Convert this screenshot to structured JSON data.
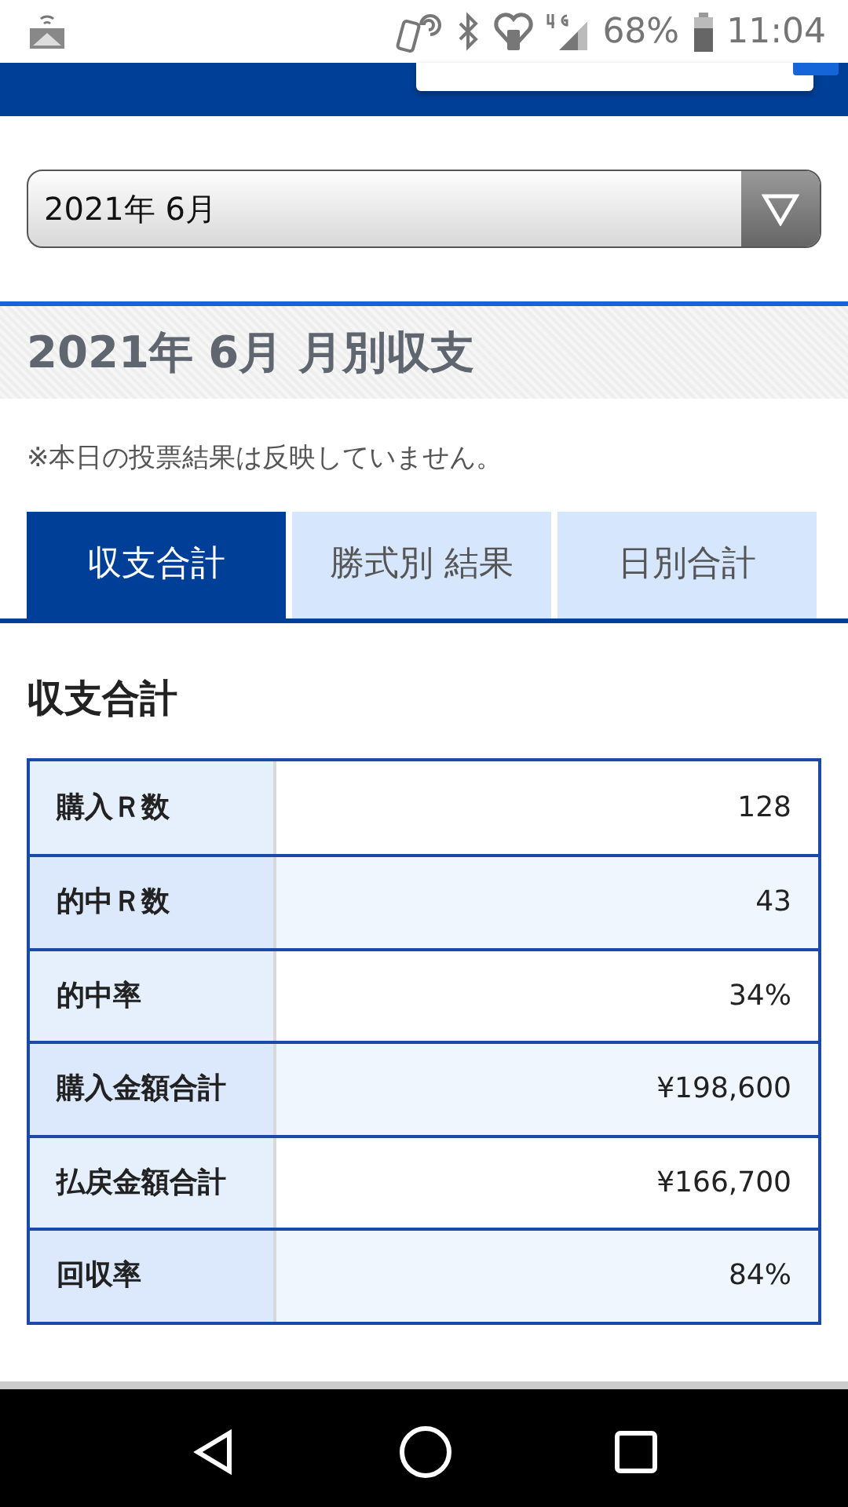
{
  "status_bar": {
    "battery": "68%",
    "time": "11:04"
  },
  "month_select": {
    "value": "2021年 6月"
  },
  "section_title": "2021年 6月 月別収支",
  "note": "※本日の投票結果は反映していません。",
  "tabs": [
    {
      "label": "収支合計",
      "selected": true
    },
    {
      "label": "勝式別 結果",
      "selected": false
    },
    {
      "label": "日別合計",
      "selected": false
    }
  ],
  "summary_title": "収支合計",
  "rows": [
    {
      "label": "購入Ｒ数",
      "value": "128"
    },
    {
      "label": "的中Ｒ数",
      "value": "43"
    },
    {
      "label": "的中率",
      "value": "34%"
    },
    {
      "label": "購入金額合計",
      "value": "¥198,600"
    },
    {
      "label": "払戻金額合計",
      "value": "¥166,700"
    },
    {
      "label": "回収率",
      "value": "84%"
    }
  ]
}
